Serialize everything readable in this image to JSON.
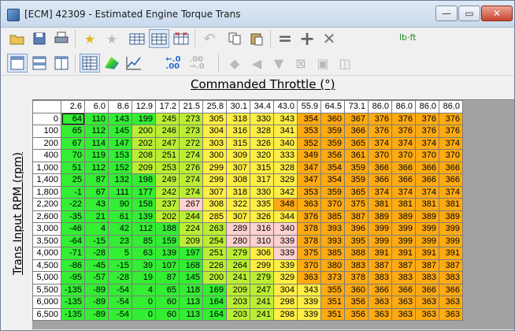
{
  "window": {
    "title": "[ECM] 42309 - Estimated Engine Torque Trans"
  },
  "window_controls": {
    "minimize": "—",
    "maximize": "▭",
    "close": "✕"
  },
  "toolbar": {
    "units_value": "",
    "units_label": "lb·ft",
    "icons_row1": [
      "open-folder-icon",
      "save-icon",
      "print-icon",
      "add-favorite-icon",
      "remove-favorite-icon",
      "compare-table-icon",
      "difference-table-icon",
      "compare-red-icon",
      "undo-icon",
      "copy-icon",
      "paste-icon",
      "equals-icon",
      "plus-icon",
      "multiply-icon"
    ],
    "icons_row2": [
      "table-view-icon",
      "split-horizontal-icon",
      "split-vertical-icon",
      "grid-view-icon",
      "3d-surface-icon",
      "line-graph-icon",
      "increase-decimals-icon",
      "decrease-decimals-icon",
      "interpolate-icon",
      "smooth-left-icon",
      "smooth-down-icon",
      "fill-icon",
      "fill-horizontal-icon",
      "fill-vertical-icon"
    ]
  },
  "colors": {
    "green": "#33ee33",
    "yellowgreen": "#bbee33",
    "yellow": "#ffee44",
    "orange": "#ffaa11",
    "pink": "#ffd0d0",
    "gray": "#a3a3a3"
  },
  "axes": {
    "x_title": "Commanded Throttle (°)",
    "y_title": "Trans Input RPM (rpm)"
  },
  "table": {
    "columns": [
      "2.6",
      "6.0",
      "8.6",
      "12.9",
      "17.2",
      "21.5",
      "25.8",
      "30.1",
      "34.4",
      "43.0",
      "55.9",
      "64.5",
      "73.1",
      "86.0",
      "86.0",
      "86.0",
      "86.0"
    ],
    "rows": [
      {
        "rpm": "0",
        "vals": [
          "64",
          "110",
          "143",
          "199",
          "245",
          "273",
          "305",
          "318",
          "330",
          "343",
          "354",
          "360",
          "367",
          "376",
          "376",
          "376",
          "376"
        ]
      },
      {
        "rpm": "100",
        "vals": [
          "65",
          "112",
          "145",
          "200",
          "246",
          "273",
          "304",
          "316",
          "328",
          "341",
          "353",
          "359",
          "366",
          "376",
          "376",
          "376",
          "376"
        ]
      },
      {
        "rpm": "200",
        "vals": [
          "67",
          "114",
          "147",
          "202",
          "247",
          "272",
          "303",
          "315",
          "326",
          "340",
          "352",
          "359",
          "365",
          "374",
          "374",
          "374",
          "374"
        ]
      },
      {
        "rpm": "400",
        "vals": [
          "70",
          "119",
          "153",
          "208",
          "251",
          "274",
          "300",
          "309",
          "320",
          "333",
          "349",
          "356",
          "361",
          "370",
          "370",
          "370",
          "370"
        ]
      },
      {
        "rpm": "1,000",
        "vals": [
          "51",
          "112",
          "152",
          "209",
          "253",
          "276",
          "299",
          "307",
          "315",
          "328",
          "347",
          "354",
          "359",
          "366",
          "366",
          "366",
          "366"
        ]
      },
      {
        "rpm": "1,400",
        "vals": [
          "25",
          "87",
          "132",
          "198",
          "249",
          "274",
          "299",
          "308",
          "317",
          "329",
          "347",
          "354",
          "359",
          "366",
          "366",
          "366",
          "366"
        ]
      },
      {
        "rpm": "1,800",
        "vals": [
          "-1",
          "67",
          "111",
          "177",
          "242",
          "274",
          "307",
          "318",
          "330",
          "342",
          "353",
          "359",
          "365",
          "374",
          "374",
          "374",
          "374"
        ]
      },
      {
        "rpm": "2,200",
        "vals": [
          "-22",
          "43",
          "90",
          "158",
          "237",
          "267",
          "308",
          "322",
          "335",
          "348",
          "363",
          "370",
          "375",
          "381",
          "381",
          "381",
          "381"
        ]
      },
      {
        "rpm": "2,600",
        "vals": [
          "-35",
          "21",
          "61",
          "139",
          "202",
          "244",
          "285",
          "307",
          "326",
          "344",
          "376",
          "385",
          "387",
          "389",
          "389",
          "389",
          "389"
        ]
      },
      {
        "rpm": "3,000",
        "vals": [
          "-46",
          "4",
          "42",
          "112",
          "188",
          "224",
          "263",
          "289",
          "316",
          "340",
          "378",
          "393",
          "396",
          "399",
          "399",
          "399",
          "399"
        ]
      },
      {
        "rpm": "3,500",
        "vals": [
          "-64",
          "-15",
          "23",
          "85",
          "159",
          "209",
          "254",
          "280",
          "310",
          "339",
          "378",
          "393",
          "395",
          "399",
          "399",
          "399",
          "399"
        ]
      },
      {
        "rpm": "4,000",
        "vals": [
          "-71",
          "-28",
          "5",
          "63",
          "139",
          "197",
          "251",
          "279",
          "306",
          "339",
          "375",
          "385",
          "388",
          "391",
          "391",
          "391",
          "391"
        ]
      },
      {
        "rpm": "4,500",
        "vals": [
          "-86",
          "-45",
          "-15",
          "39",
          "107",
          "168",
          "226",
          "264",
          "299",
          "339",
          "370",
          "380",
          "383",
          "387",
          "387",
          "387",
          "387"
        ]
      },
      {
        "rpm": "5,000",
        "vals": [
          "-95",
          "-57",
          "-28",
          "19",
          "87",
          "145",
          "200",
          "241",
          "279",
          "329",
          "363",
          "373",
          "378",
          "383",
          "383",
          "383",
          "383"
        ]
      },
      {
        "rpm": "5,500",
        "vals": [
          "-135",
          "-89",
          "-54",
          "4",
          "65",
          "118",
          "169",
          "209",
          "247",
          "304",
          "343",
          "355",
          "360",
          "366",
          "366",
          "366",
          "366"
        ]
      },
      {
        "rpm": "6,000",
        "vals": [
          "-135",
          "-89",
          "-54",
          "0",
          "60",
          "113",
          "164",
          "203",
          "241",
          "298",
          "339",
          "351",
          "356",
          "363",
          "363",
          "363",
          "363"
        ]
      },
      {
        "rpm": "6,500",
        "vals": [
          "-135",
          "-89",
          "-54",
          "0",
          "60",
          "113",
          "164",
          "203",
          "241",
          "298",
          "339",
          "351",
          "356",
          "363",
          "363",
          "363",
          "363"
        ]
      }
    ],
    "pink_cells": [
      [
        7,
        5
      ],
      [
        9,
        7
      ],
      [
        9,
        8
      ],
      [
        9,
        9
      ],
      [
        10,
        7
      ],
      [
        10,
        8
      ],
      [
        10,
        9
      ],
      [
        11,
        9
      ]
    ],
    "selected_cell": [
      0,
      0
    ]
  }
}
